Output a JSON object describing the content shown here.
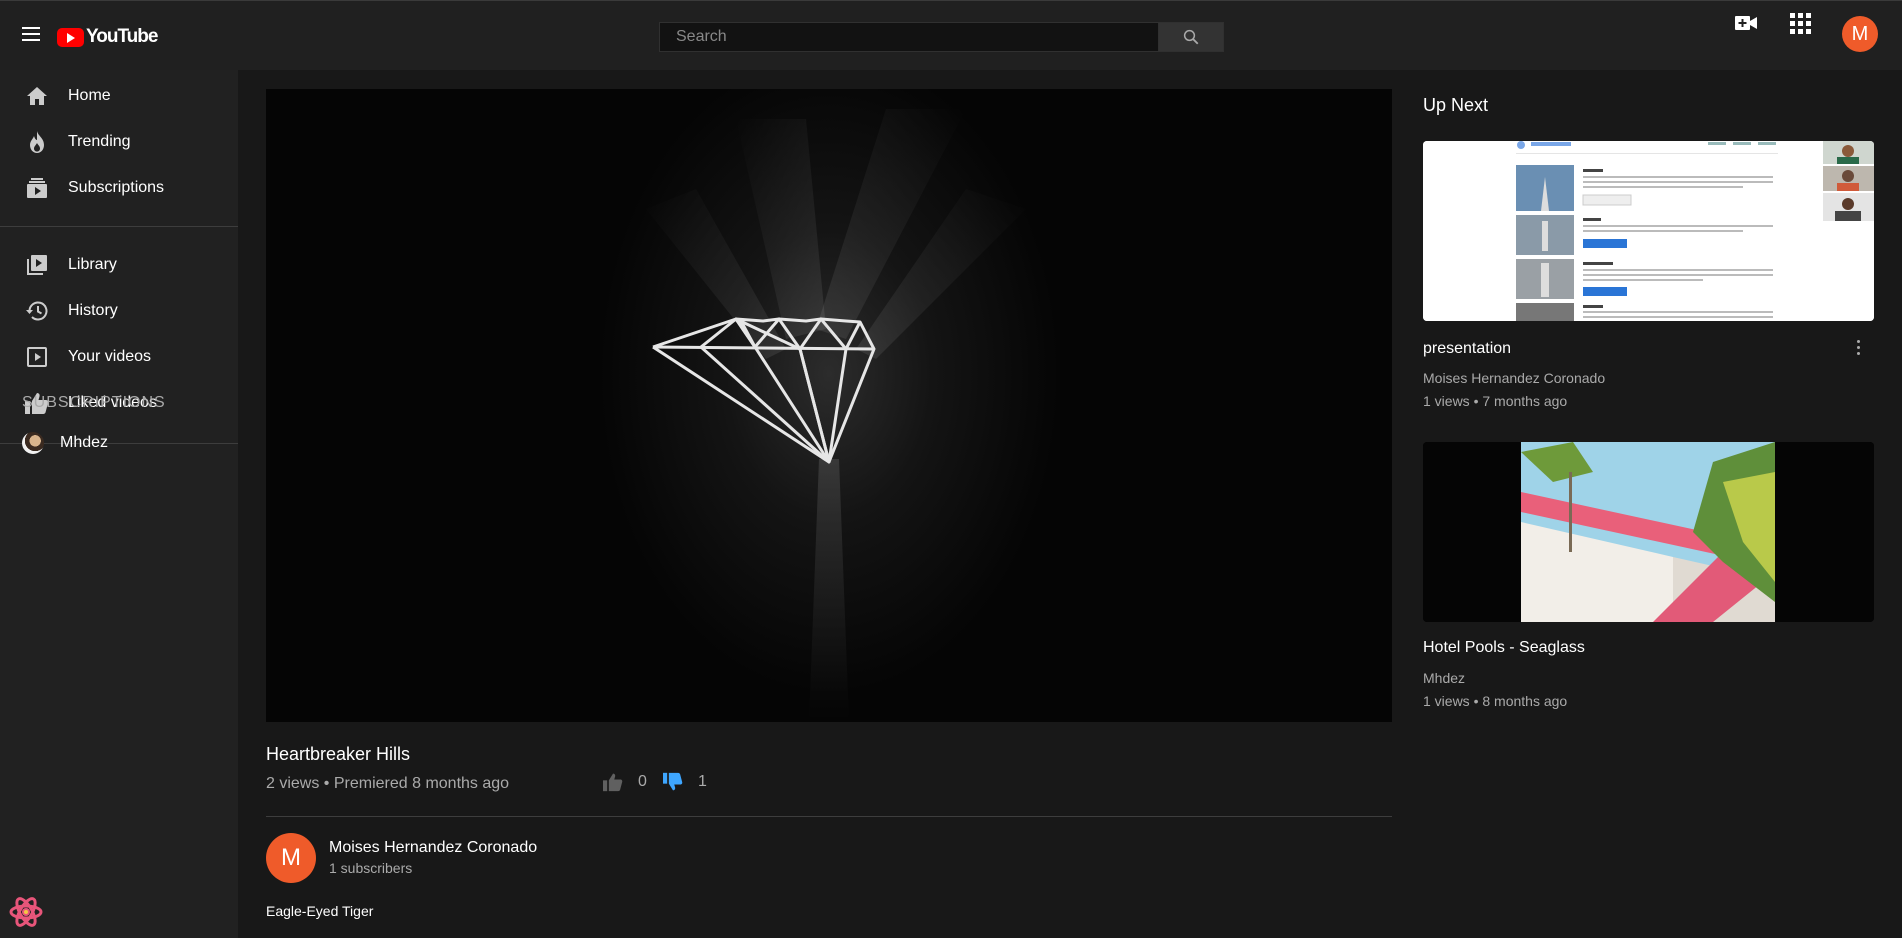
{
  "header": {
    "logo_text": "YouTube",
    "search_placeholder": "Search",
    "avatar_letter": "M"
  },
  "sidebar": {
    "items": [
      {
        "label": "Home",
        "icon": "home-icon"
      },
      {
        "label": "Trending",
        "icon": "flame-icon"
      },
      {
        "label": "Subscriptions",
        "icon": "subscriptions-icon"
      },
      {
        "label": "Library",
        "icon": "library-icon"
      },
      {
        "label": "History",
        "icon": "history-icon"
      },
      {
        "label": "Your videos",
        "icon": "play-square-icon"
      },
      {
        "label": "Liked videos",
        "icon": "thumbs-up-icon"
      }
    ],
    "subscriptions_heading": "SUBSCRIPTIONS",
    "subscriptions": [
      {
        "label": "Mhdez"
      }
    ]
  },
  "video": {
    "title": "Heartbreaker Hills",
    "meta": "2 views • Premiered 8 months ago",
    "likes": "0",
    "dislikes": "1",
    "owner_letter": "M",
    "owner_name": "Moises Hernandez Coronado",
    "owner_subscribers": "1 subscribers",
    "description": "Eagle-Eyed Tiger"
  },
  "up_next": {
    "heading": "Up Next",
    "cards": [
      {
        "title": "presentation",
        "channel": "Moises Hernandez Coronado",
        "stats": "1 views  •  7 months ago"
      },
      {
        "title": "Hotel Pools - Seaglass",
        "channel": "Mhdez",
        "stats": "1 views  •  8 months ago"
      }
    ]
  },
  "colors": {
    "background": "#181818",
    "surface": "#212121",
    "accent_avatar": "#ef5b2a",
    "dislike_active": "#3ea6ff",
    "logo_red": "#ff0000"
  }
}
